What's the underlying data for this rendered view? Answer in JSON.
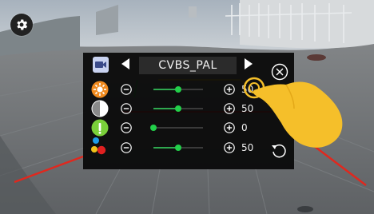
{
  "overlay": {
    "title": "CVBS_PAL",
    "rows": [
      {
        "name": "brightness",
        "value": "50",
        "level": 0.5
      },
      {
        "name": "contrast",
        "value": "50",
        "level": 0.5
      },
      {
        "name": "info",
        "value": "0",
        "level": 0.0
      },
      {
        "name": "color",
        "value": "50",
        "level": 0.5
      }
    ]
  },
  "colors": {
    "accent": "#22d04a",
    "brightness_icon": "#f08a1e",
    "info_icon": "#7ad03a",
    "guide_red": "#e0281e",
    "guide_yellow": "#d8c21e",
    "guide_green": "#2fb84a",
    "hand": "#f5bf2a"
  },
  "icons": [
    "settings-gear-icon",
    "camera-source-icon",
    "arrow-left-icon",
    "arrow-right-icon",
    "close-icon",
    "brightness-icon",
    "contrast-icon",
    "info-icon",
    "color-palette-icon",
    "minus-icon",
    "plus-icon",
    "undo-icon",
    "tap-hand-icon"
  ]
}
